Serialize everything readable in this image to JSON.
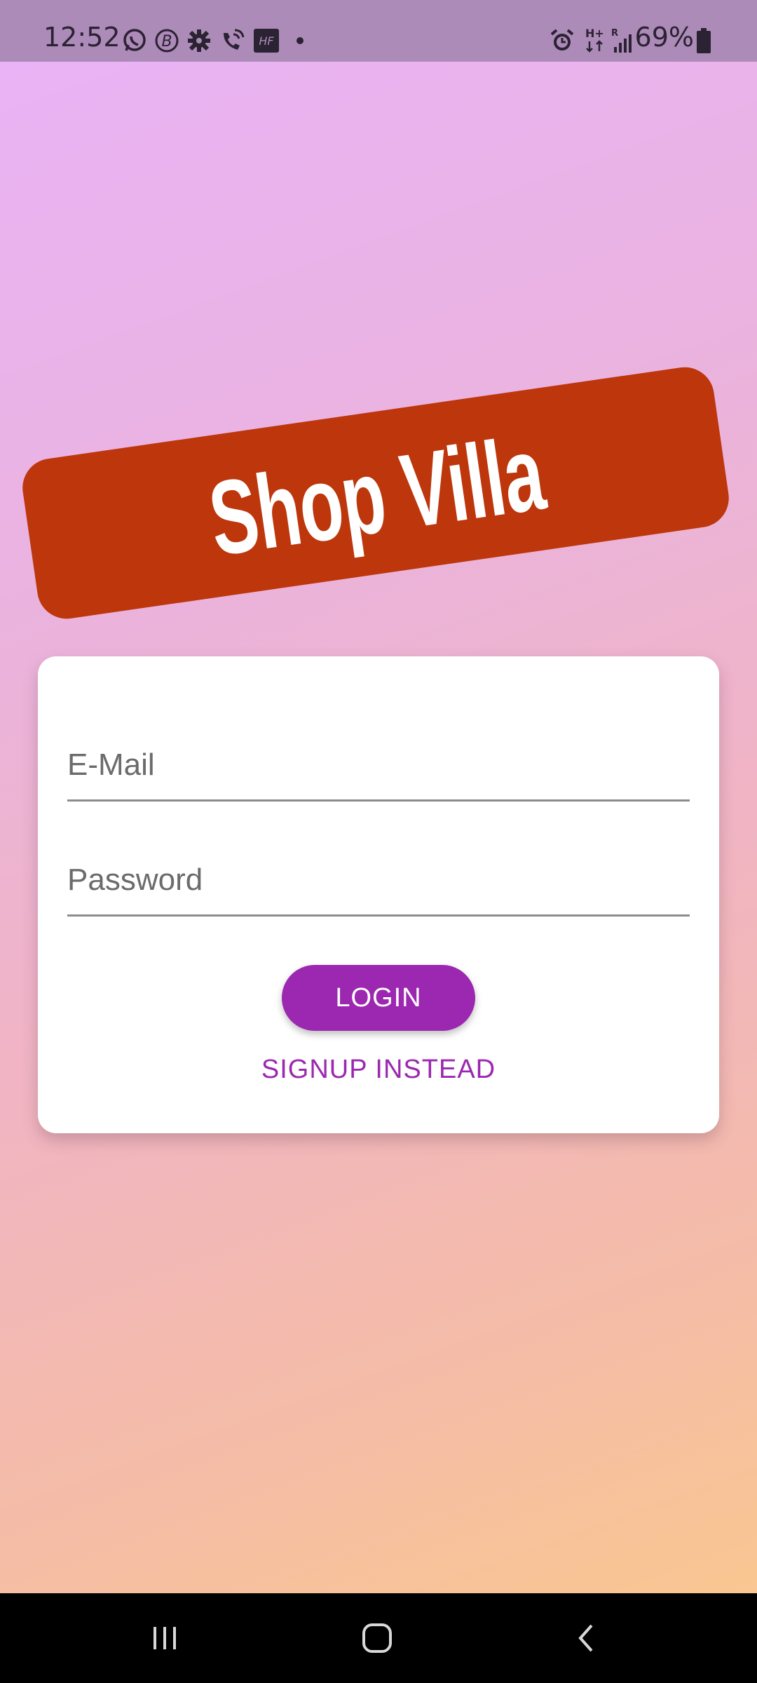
{
  "status_bar": {
    "time": "12:52",
    "battery": "69%",
    "icons": [
      "whatsapp-icon",
      "b-app-icon",
      "settings-gear-icon",
      "wifi-call-icon",
      "hf-badge-icon",
      "notification-dot-icon",
      "alarm-icon",
      "network-h-plus-icon",
      "signal-bars-icon",
      "battery-icon"
    ],
    "hf_label": "HF",
    "network_label": "H+",
    "roaming_label": "R"
  },
  "logo": {
    "text": "Shop Villa",
    "color": "#bd360c"
  },
  "login_form": {
    "email_placeholder": "E-Mail",
    "password_placeholder": "Password",
    "login_label": "LOGIN",
    "signup_label": "SIGNUP INSTEAD",
    "accent_color": "#9c27b0"
  },
  "nav_bar": {
    "icons": [
      "recent-apps-icon",
      "home-icon",
      "back-icon"
    ]
  }
}
